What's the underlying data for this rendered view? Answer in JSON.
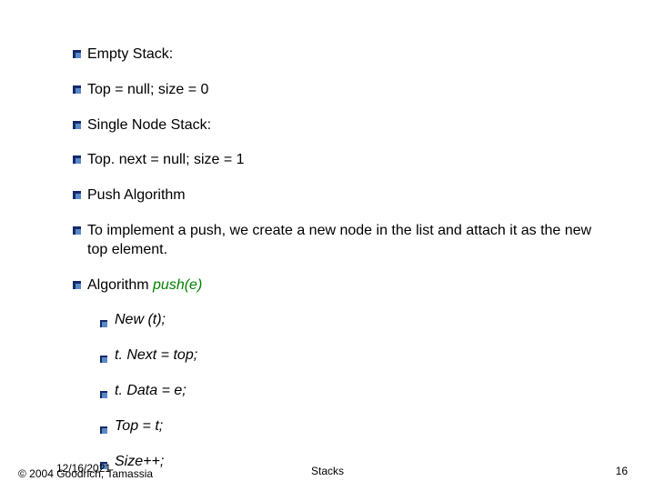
{
  "lines": {
    "l0": "Empty Stack:",
    "l1": "Top = null; size = 0",
    "l2": "Single Node Stack:",
    "l3": "Top. next = null; size = 1",
    "l4": "Push Algorithm",
    "l5": "To implement a push, we create a new node in the list and attach it as the new top element.",
    "l6a": "Algorithm ",
    "l6b": "push(e)",
    "l7": "New (t);",
    "l8": "t. Next = top;",
    "l9": "t. Data = e;",
    "l10": "Top = t;",
    "l11": "Size++;"
  },
  "footer": {
    "date": "12/16/2021",
    "copyright": "© 2004 Goodrich, Tamassia",
    "center": "Stacks",
    "page": "16"
  },
  "colors": {
    "bulletDark": "#152a6a",
    "bulletLight": "#5a8ac6",
    "pushColor": "#008000"
  }
}
